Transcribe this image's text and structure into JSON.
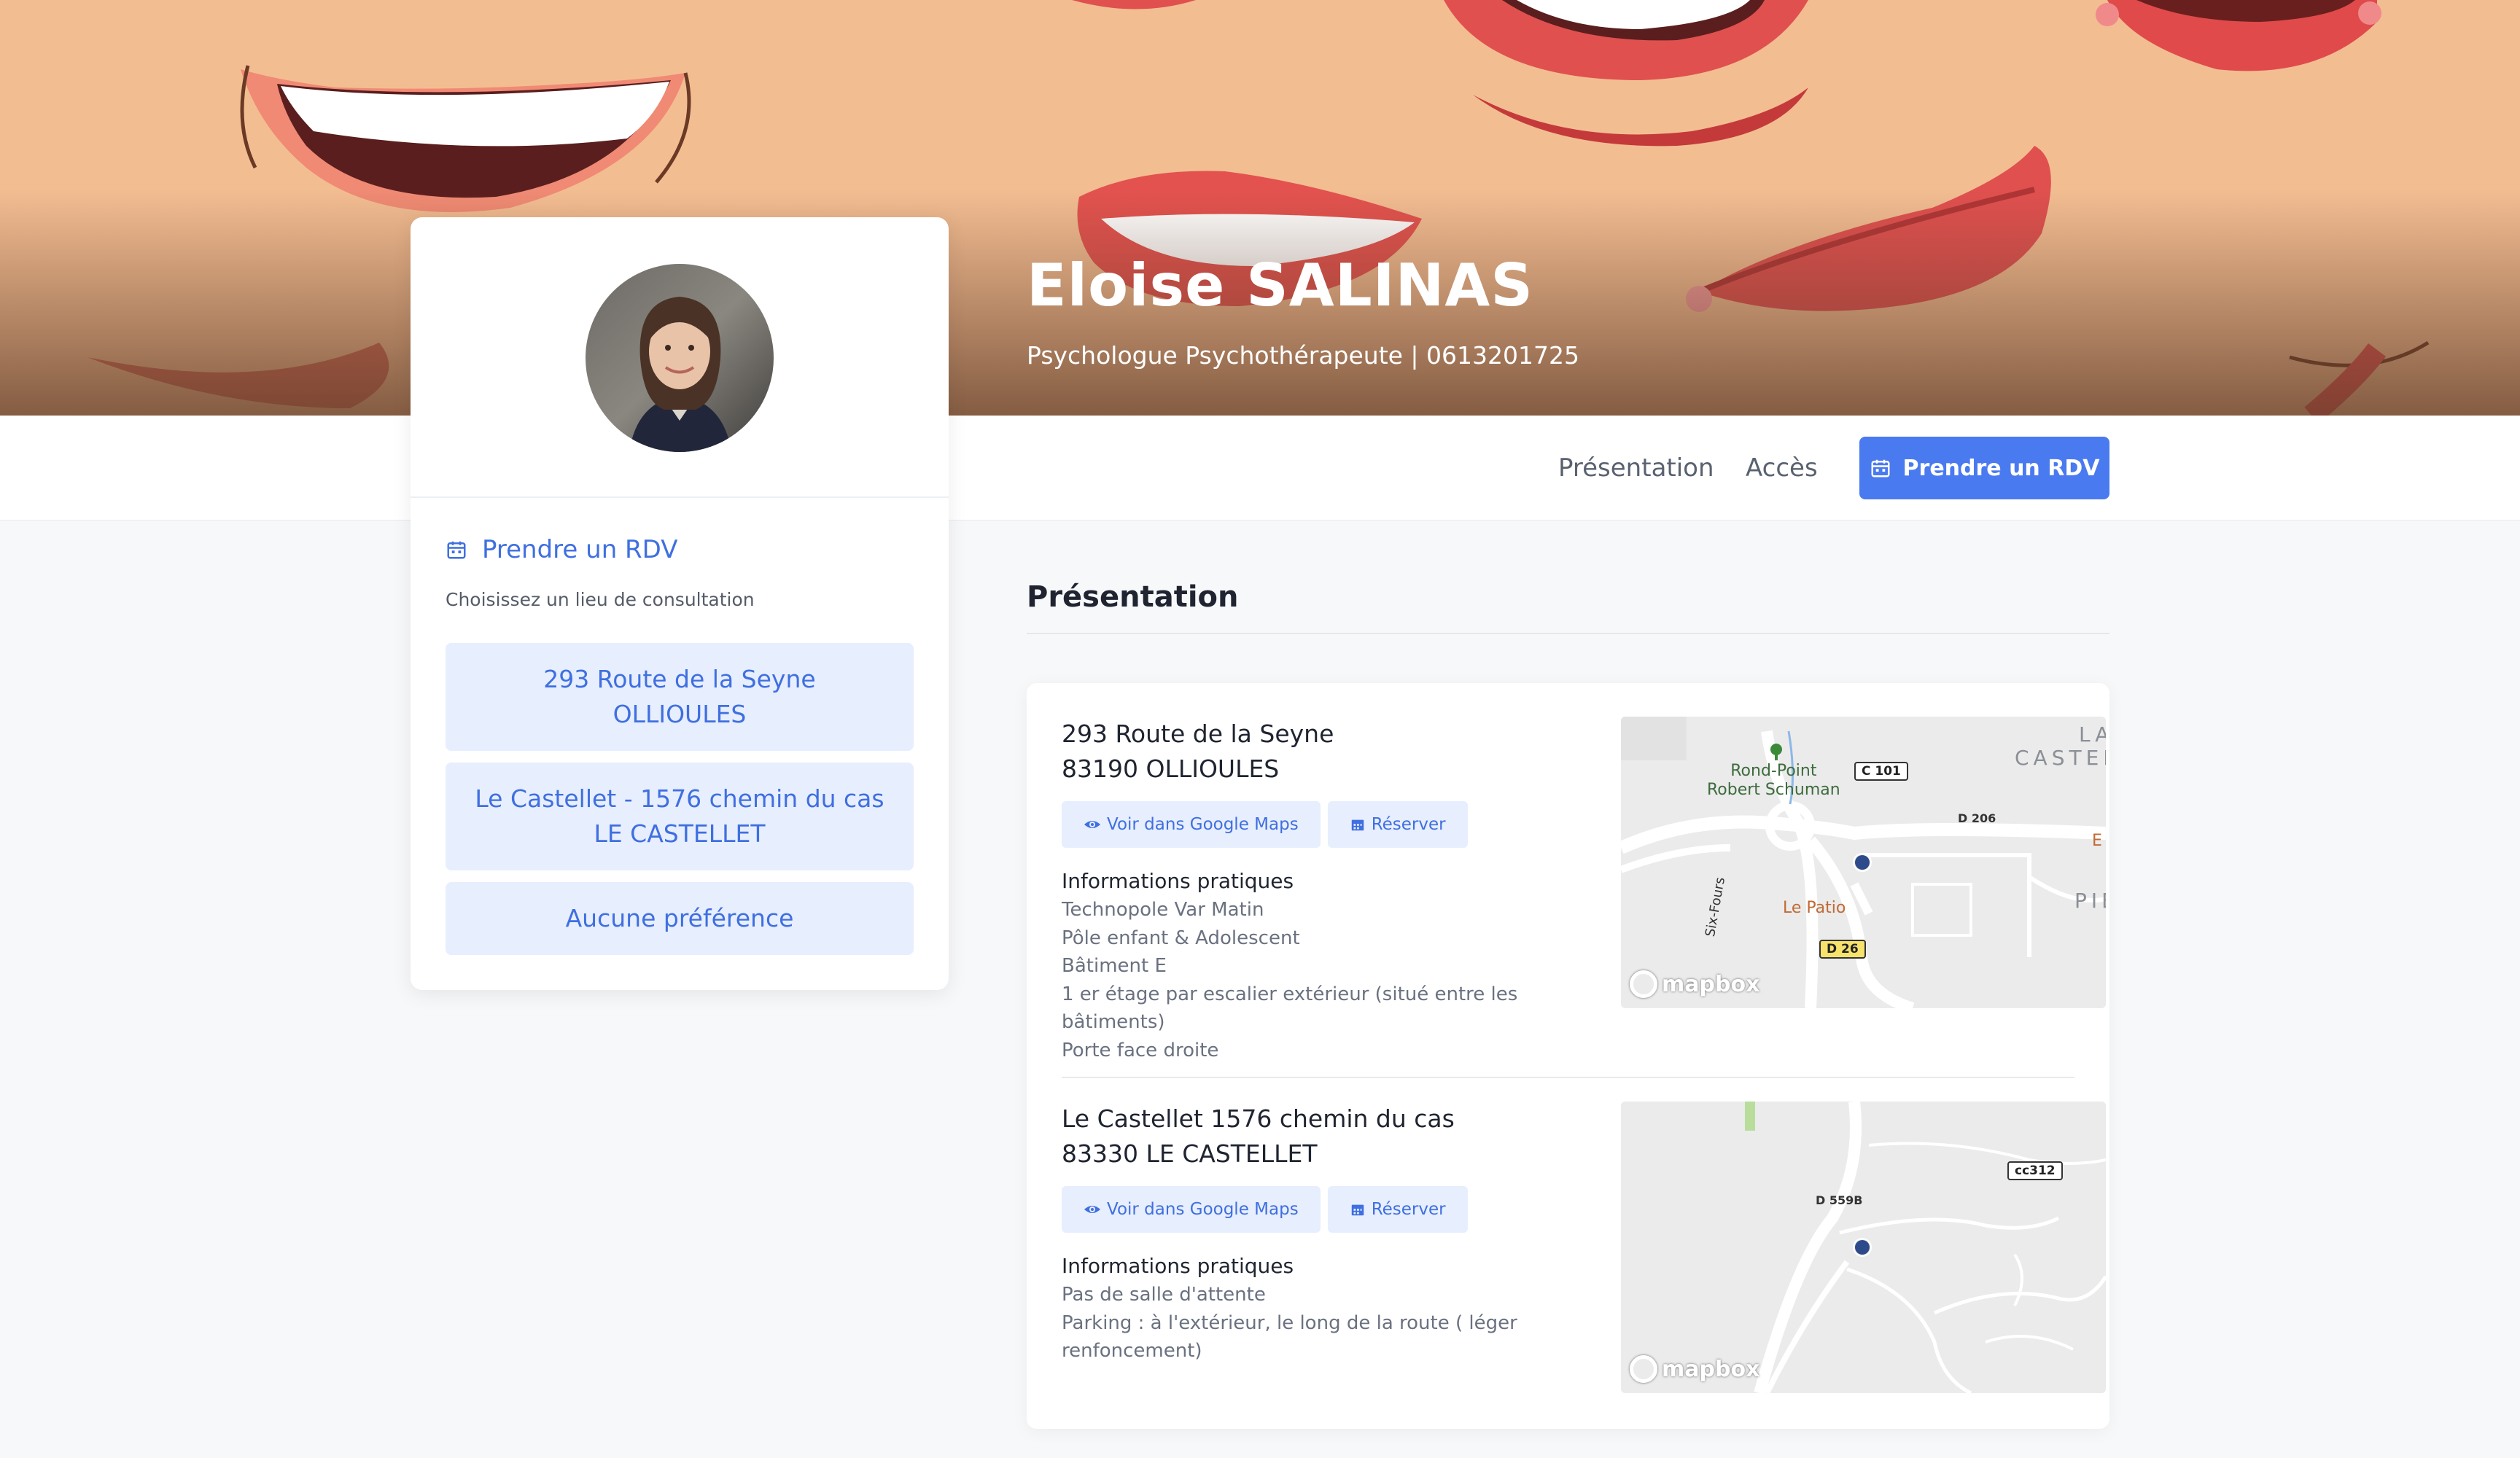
{
  "hero": {
    "name": "Eloise SALINAS",
    "subtitle": "Psychologue Psychothérapeute | 0613201725"
  },
  "nav": {
    "presentation": "Présentation",
    "acces": "Accès",
    "rdv_button": "Prendre un RDV"
  },
  "profile_card": {
    "rdv_title": "Prendre un RDV",
    "choose_label": "Choisissez un lieu de consultation",
    "locations": [
      {
        "line1": "293 Route de la Seyne",
        "line2": "OLLIOULES"
      },
      {
        "line1": "Le Castellet - 1576 chemin du cas",
        "line2": "LE CASTELLET"
      },
      {
        "line1": "Aucune préférence",
        "line2": ""
      }
    ]
  },
  "presentation": {
    "title": "Présentation",
    "places": [
      {
        "address_line1": "293 Route de la Seyne",
        "address_line2": "83190 OLLIOULES",
        "maps_button": "Voir dans Google Maps",
        "reserve_button": "Réserver",
        "info_title": "Informations pratiques",
        "info_lines": [
          "Technopole Var Matin",
          "Pôle enfant & Adolescent",
          "Bâtiment E",
          "1 er étage par escalier extérieur (situé entre les bâtiments)",
          "Porte face droite"
        ],
        "map": {
          "labels": [
            "Rond-Point",
            "Robert Schuman",
            "C 101",
            "D 206",
            "Le Patio",
            "D 26",
            "LA",
            "CASTEL",
            "PIE",
            "E",
            "Six-Fours"
          ],
          "logo": "mapbox"
        }
      },
      {
        "address_line1": "Le Castellet 1576 chemin du cas",
        "address_line2": "83330 LE CASTELLET",
        "maps_button": "Voir dans Google Maps",
        "reserve_button": "Réserver",
        "info_title": "Informations pratiques",
        "info_lines": [
          "Pas de salle d'attente",
          "Parking : à l'extérieur, le long de la route ( léger renfoncement)"
        ],
        "map": {
          "labels": [
            "D 559B",
            "cc312"
          ],
          "logo": "mapbox"
        }
      }
    ]
  },
  "colors": {
    "accent": "#4a7af0",
    "accent_light": "#e7eefe",
    "hero_bg": "#f3bd92",
    "lips": "#e0504f"
  },
  "icons": {
    "calendar": "calendar-icon",
    "eye": "eye-icon",
    "marker": "map-marker-icon"
  }
}
